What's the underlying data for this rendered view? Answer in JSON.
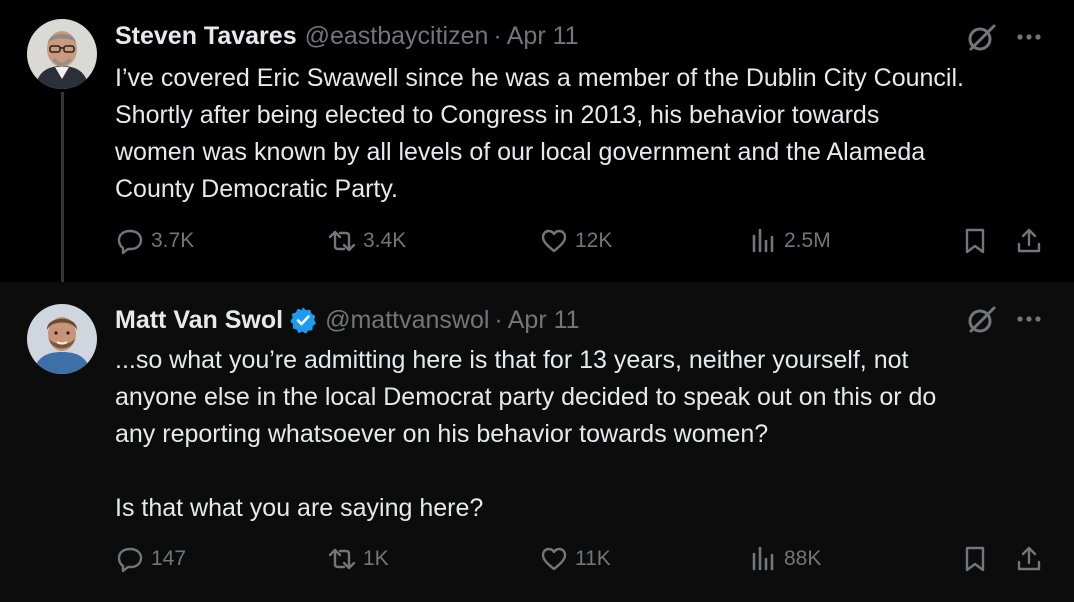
{
  "tweets": [
    {
      "name": "Steven Tavares",
      "handle": "@eastbaycitizen",
      "separator": "·",
      "date": "Apr 11",
      "verified": false,
      "text": "I’ve covered Eric Swawell since he was a member of the Dublin City Council.\nShortly after being elected to Congress in 2013, his behavior towards\nwomen was known by all levels of our local government and the Alameda\nCounty Democratic Party.",
      "stats": {
        "replies": "3.7K",
        "reposts": "3.4K",
        "likes": "12K",
        "views": "2.5M"
      }
    },
    {
      "name": "Matt Van Swol",
      "handle": "@mattvanswol",
      "separator": "·",
      "date": "Apr 11",
      "verified": true,
      "text": "...so what you’re admitting here is that for 13 years, neither yourself, not\nanyone else in the local Democrat party decided to speak out on this or do\nany reporting whatsoever on his behavior towards women?\n\nIs that what you are saying here?",
      "stats": {
        "replies": "147",
        "reposts": "1K",
        "likes": "11K",
        "views": "88K"
      }
    }
  ],
  "colors": {
    "background": "#000000",
    "reply_background": "#0c0c0c",
    "text": "#e7e9ea",
    "muted": "#71767b",
    "verified_badge": "#1d9bf0"
  },
  "icons": [
    "grok-icon",
    "more-icon",
    "reply-icon",
    "repost-icon",
    "like-icon",
    "views-icon",
    "bookmark-icon",
    "share-icon",
    "verified-badge-icon"
  ]
}
